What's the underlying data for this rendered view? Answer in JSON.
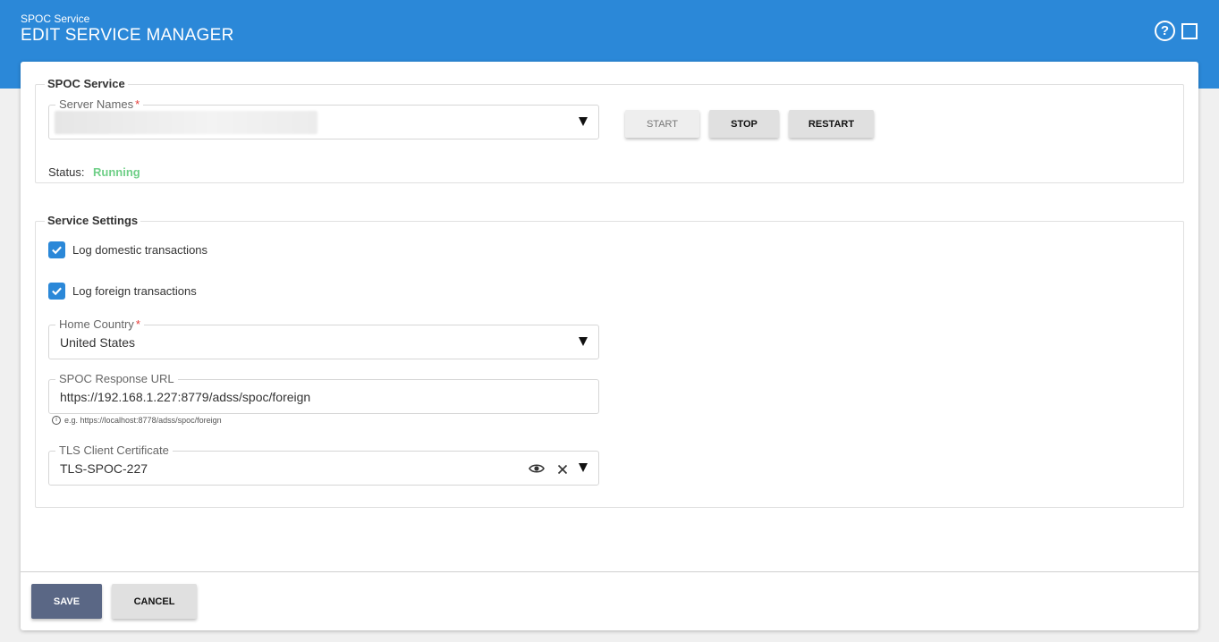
{
  "header": {
    "subtitle": "SPOC Service",
    "title": "EDIT SERVICE MANAGER",
    "help_icon": "help-circle-icon",
    "maximize_icon": "maximize-icon"
  },
  "spoc_service": {
    "legend": "SPOC Service",
    "server_names": {
      "label": "Server Names",
      "required_mark": "*",
      "value": ""
    },
    "buttons": {
      "start": "START",
      "stop": "STOP",
      "restart": "RESTART"
    },
    "status_label": "Status:",
    "status_value": "Running"
  },
  "service_settings": {
    "legend": "Service Settings",
    "log_domestic": {
      "label": "Log domestic transactions",
      "checked": true
    },
    "log_foreign": {
      "label": "Log foreign transactions",
      "checked": true
    },
    "home_country": {
      "label": "Home Country",
      "required_mark": "*",
      "value": "United States"
    },
    "response_url": {
      "label": "SPOC Response URL",
      "value": "https://192.168.1.227:8779/adss/spoc/foreign",
      "hint": "e.g. https://localhost:8778/adss/spoc/foreign"
    },
    "tls_cert": {
      "label": "TLS Client Certificate",
      "value": "TLS-SPOC-227"
    }
  },
  "footer": {
    "save": "SAVE",
    "cancel": "CANCEL"
  },
  "colors": {
    "header": "#2b88d8",
    "status_running": "#6fcf87",
    "primary_button": "#5a6785",
    "checkbox": "#2b88d8"
  }
}
